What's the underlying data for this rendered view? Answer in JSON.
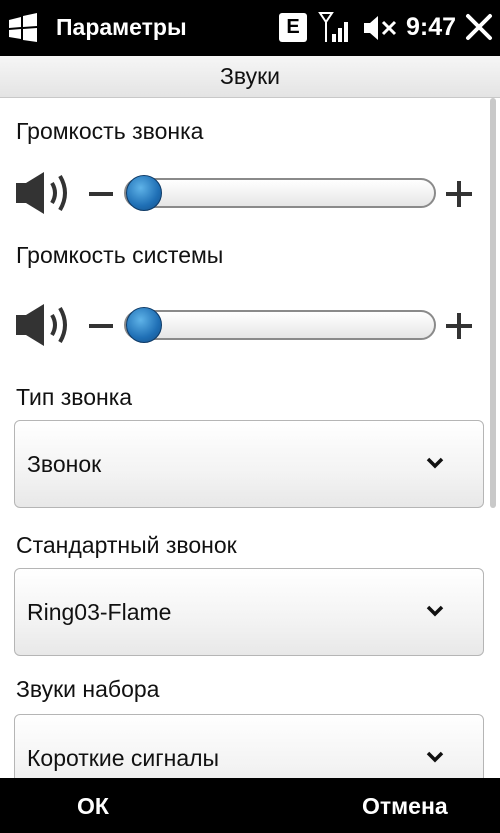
{
  "statusbar": {
    "app_title": "Параметры",
    "badge": "E",
    "time": "9:47",
    "icons": [
      "windows-start-icon",
      "signal-strength-icon",
      "speaker-muted-icon",
      "close-icon"
    ]
  },
  "header": {
    "title": "Звуки"
  },
  "ringer_volume": {
    "label": "Громкость звонка",
    "level": 0
  },
  "system_volume": {
    "label": "Громкость системы",
    "level": 0
  },
  "ring_type": {
    "label": "Тип звонка",
    "value": "Звонок"
  },
  "ring_tone": {
    "label": "Стандартный звонок",
    "value": "Ring03-Flame"
  },
  "keypad": {
    "label": "Звуки набора",
    "value": "Короткие сигналы"
  },
  "softkeys": {
    "left": "ОК",
    "right": "Отмена"
  },
  "colors": {
    "slider_knob": "#1f6fb5",
    "background": "#ffffff",
    "bars": "#000000"
  }
}
